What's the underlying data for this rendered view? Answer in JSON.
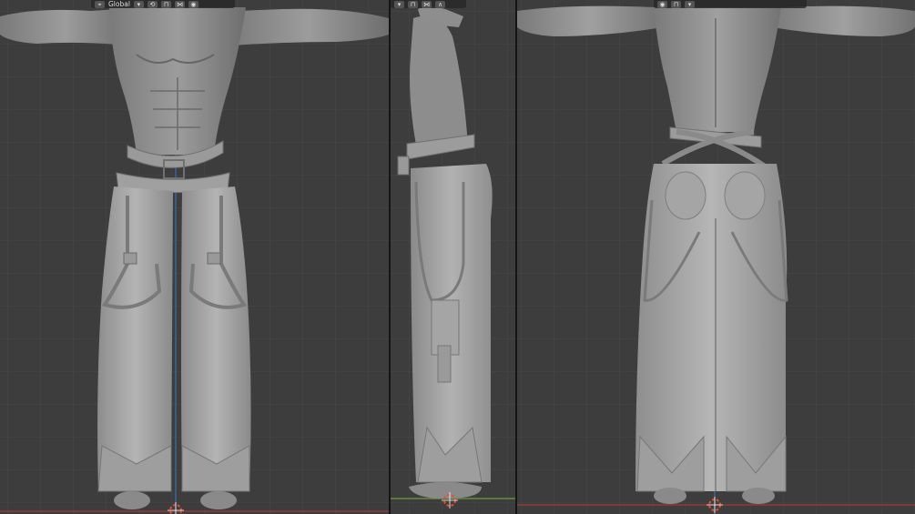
{
  "app": "Blender",
  "viewports": [
    {
      "id": "front",
      "header": {
        "orientation_label": "Global",
        "orientation_icon": "orientation-axes-icon",
        "pivot_icon": "pivot-point-icon",
        "snap_icon": "snap-magnet-icon",
        "proportional_icon": "proportional-edit-icon",
        "overlay_icon": "overlay-circle-icon"
      }
    },
    {
      "id": "side",
      "header": {
        "snap_icon": "snap-magnet-icon",
        "proportional_icon": "proportional-edit-icon",
        "falloff_icon": "falloff-curve-icon"
      }
    },
    {
      "id": "back",
      "header": {
        "overlay_icon": "overlay-circle-icon",
        "snap_icon": "snap-magnet-icon"
      }
    }
  ],
  "colors": {
    "viewport_bg": "#3d3d3d",
    "grid_line": "#454545",
    "x_axis": "#a33a3a",
    "y_axis": "#6f9b3a",
    "z_axis": "#3a6fb5",
    "model": "#a9a9a9",
    "model_dark": "#6a6a6a",
    "cursor": "#e05030"
  },
  "icons": {
    "cursor": "3d-cursor-icon",
    "chevron": "chevron-down-icon"
  }
}
